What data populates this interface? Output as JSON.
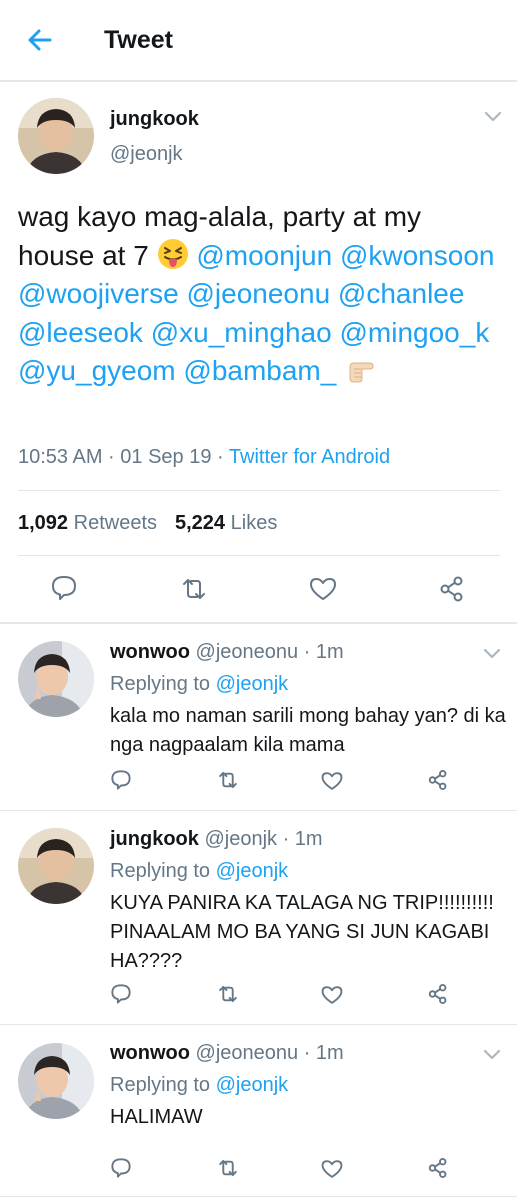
{
  "header": {
    "title": "Tweet"
  },
  "main_tweet": {
    "name": "jungkook",
    "handle": "@jeonjk",
    "text_parts": {
      "p1": "wag kayo mag-alala, party at my house at 7 ",
      "m1": "@moonjun",
      "m2": "@kwonsoon",
      "m3": "@woojiverse",
      "m4": "@jeoneonu",
      "m5": "@chanlee",
      "m6": "@leeseok",
      "m7": "@xu_minghao",
      "m8": "@mingoo_k",
      "m9": "@yu_gyeom",
      "m10": "@bambam_"
    },
    "time": "10:53 AM · 01 Sep 19 · ",
    "source": "Twitter for Android",
    "retweets_count": "1,092",
    "retweets_label": "Retweets",
    "likes_count": "5,224",
    "likes_label": "Likes"
  },
  "replies": [
    {
      "name": "wonwoo",
      "handle": "@jeoneonu · 1m",
      "replying_prefix": "Replying to ",
      "replying_to": "@jeonjk",
      "text": "kala mo naman sarili mong bahay yan? di ka nga nagpaalam kila mama"
    },
    {
      "name": "jungkook",
      "handle": "@jeonjk · 1m",
      "replying_prefix": "Replying to ",
      "replying_to": "@jeonjk",
      "text": "KUYA PANIRA KA TALAGA NG TRIP!!!!!!!!!! PINAALAM MO BA YANG SI JUN KAGABI HA????"
    },
    {
      "name": "wonwoo",
      "handle": "@jeoneonu · 1m",
      "replying_prefix": "Replying to ",
      "replying_to": "@jeonjk",
      "text": "HALIMAW"
    }
  ],
  "icons": {
    "back": "arrow-left-icon",
    "more": "chevron-down-icon",
    "reply": "comment-icon",
    "retweet": "retweet-icon",
    "like": "heart-icon",
    "share": "share-icon"
  },
  "colors": {
    "accent": "#1da1f2",
    "muted": "#657786",
    "text": "#14171a",
    "divider": "#e1e8ed"
  }
}
